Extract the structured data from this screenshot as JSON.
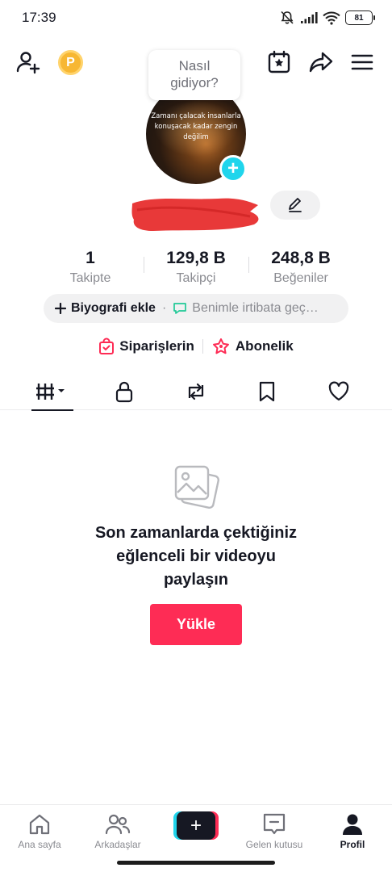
{
  "status_bar": {
    "time": "17:39",
    "battery": "81",
    "icons": [
      "mute-bell-icon",
      "signal-icon",
      "wifi-icon",
      "battery-icon"
    ]
  },
  "top_bar": {
    "coin_label": "P",
    "bubble_text_line1": "Nasıl",
    "bubble_text_line2": "gidiyor?"
  },
  "profile": {
    "avatar_text": "Zamanı çalacak insanlarla konuşacak kadar zengin değilim",
    "stats": [
      {
        "value": "1",
        "label": "Takipte"
      },
      {
        "value": "129,8 B",
        "label": "Takipçi"
      },
      {
        "value": "248,8 B",
        "label": "Beğeniler"
      }
    ],
    "bio_add": "Biyografi ekle",
    "bio_separator": "·",
    "bio_contact": "Benimle irtibata geç…",
    "orders_label": "Siparişlerin",
    "subscription_label": "Abonelik"
  },
  "tabs": [
    "videos-grid",
    "private",
    "reposts",
    "favorites",
    "liked"
  ],
  "empty_state": {
    "line1": "Son zamanlarda çektiğiniz",
    "line2": "eğlenceli bir videoyu",
    "line3": "paylaşın",
    "upload_label": "Yükle"
  },
  "bottom_nav": {
    "home": "Ana sayfa",
    "friends": "Arkadaşlar",
    "inbox": "Gelen kutusu",
    "profile": "Profil"
  },
  "colors": {
    "accent": "#fe2c55",
    "secondary_accent": "#20d5ec",
    "text": "#161823",
    "muted": "#8a8b91"
  }
}
